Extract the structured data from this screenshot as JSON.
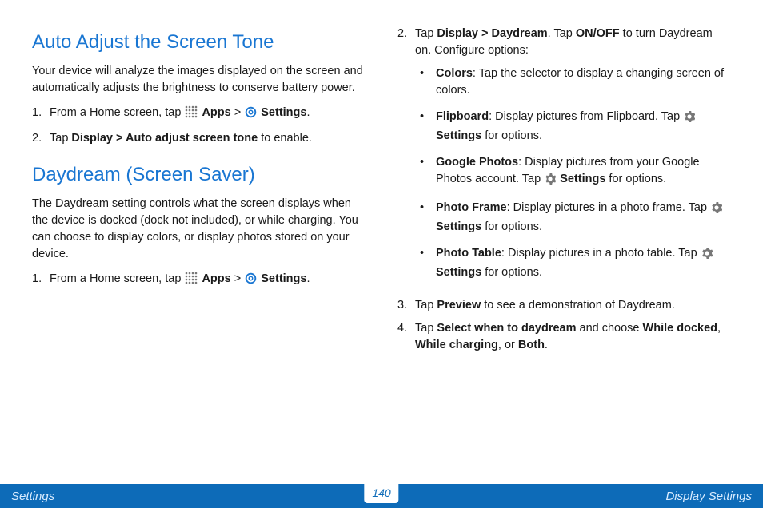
{
  "left": {
    "section1": {
      "heading": "Auto Adjust the Screen Tone",
      "intro": "Your device will analyze the images displayed on the screen and automatically adjusts the brightness to conserve battery power.",
      "steps": [
        {
          "num": "1.",
          "pre": "From a Home screen, tap ",
          "apps": "Apps",
          "gt": " > ",
          "settings": "Settings",
          "post": "."
        },
        {
          "num": "2.",
          "pre": "Tap ",
          "b1": "Display",
          "gt": " > ",
          "b2": "Auto adjust screen tone",
          "post": " to enable."
        }
      ]
    },
    "section2": {
      "heading": "Daydream (Screen Saver)",
      "intro": "The Daydream setting controls what the screen displays when the device is docked (dock not included), or while charging. You can choose to display colors, or display photos stored on your device.",
      "steps": [
        {
          "num": "1.",
          "pre": "From a Home screen, tap ",
          "apps": "Apps",
          "gt": " > ",
          "settings": "Settings",
          "post": "."
        }
      ]
    }
  },
  "right": {
    "step2": {
      "num": "2.",
      "pre": "Tap ",
      "b1": "Display",
      "gt": " > ",
      "b2": "Daydream",
      "mid": ". Tap ",
      "b3": "ON/OFF",
      "post": " to turn Daydream on. Configure options:"
    },
    "bullets": [
      {
        "title": "Colors",
        "desc": ": Tap the selector to display a changing screen of colors.",
        "hasSettings": false
      },
      {
        "title": "Flipboard",
        "desc": ": Display pictures from Flipboard. Tap ",
        "settings": "Settings",
        "post": " for options.",
        "hasSettings": true
      },
      {
        "title": "Google Photos",
        "desc": ": Display pictures from your Google Photos account. Tap ",
        "settings": "Settings",
        "post": " for options.",
        "hasSettings": true
      },
      {
        "title": "Photo Frame",
        "desc": ": Display pictures in a photo frame. Tap ",
        "settings": "Settings",
        "post": " for options.",
        "hasSettings": true
      },
      {
        "title": "Photo Table",
        "desc": ": Display pictures in a photo table. Tap ",
        "settings": "Settings",
        "post": " for options.",
        "hasSettings": true
      }
    ],
    "step3": {
      "num": "3.",
      "pre": "Tap ",
      "b1": "Preview",
      "post": " to see a demonstration of Daydream."
    },
    "step4": {
      "num": "4.",
      "pre": "Tap ",
      "b1": "Select when to daydream",
      "mid": " and choose ",
      "b2": "While docked",
      "c1": ", ",
      "b3": "While charging",
      "c2": ", or ",
      "b4": "Both",
      "post": "."
    }
  },
  "footer": {
    "left": "Settings",
    "page": "140",
    "right": "Display Settings"
  }
}
